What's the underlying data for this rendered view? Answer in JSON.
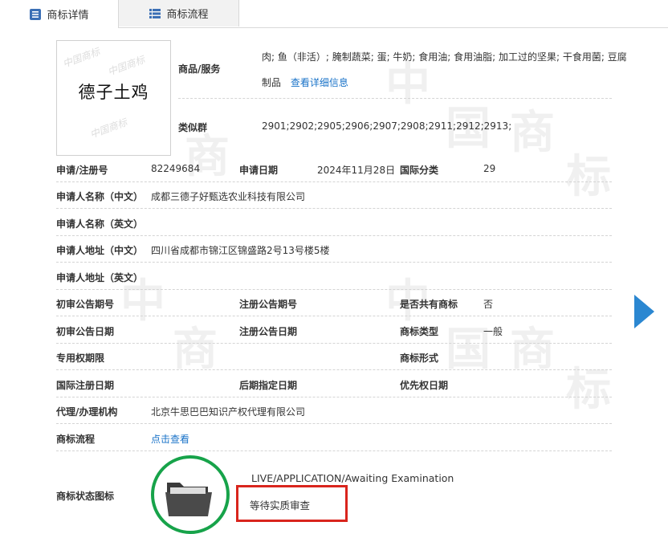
{
  "tabs": [
    {
      "label": "商标详情"
    },
    {
      "label": "商标流程"
    }
  ],
  "trademark": {
    "text": "德子土鸡"
  },
  "goods": {
    "label": "商品/服务",
    "line1": "肉; 鱼（非活）; 腌制蔬菜; 蛋; 牛奶; 食用油; 食用油脂; 加工过的坚果; 干食用菌; 豆腐",
    "line2": "制品",
    "detail_link": "查看详细信息"
  },
  "similar_group": {
    "label": "类似群",
    "value": "2901;2902;2905;2906;2907;2908;2911;2912;2913;"
  },
  "fields": {
    "reg_no_label": "申请/注册号",
    "reg_no": "82249684",
    "apply_date_label": "申请日期",
    "apply_date": "2024年11月28日",
    "intl_class_label": "国际分类",
    "intl_class": "29",
    "applicant_cn_label": "申请人名称（中文）",
    "applicant_cn": "成都三德子好甄选农业科技有限公司",
    "applicant_en_label": "申请人名称（英文）",
    "address_cn_label": "申请人地址（中文）",
    "address_cn": "四川省成都市锦江区锦盛路2号13号楼5楼",
    "address_en_label": "申请人地址（英文）",
    "prelim_no_label": "初审公告期号",
    "reg_pub_no_label": "注册公告期号",
    "shared_label": "是否共有商标",
    "shared": "否",
    "prelim_date_label": "初审公告日期",
    "reg_pub_date_label": "注册公告日期",
    "tm_type_label": "商标类型",
    "tm_type": "一般",
    "exclusive_label": "专用权期限",
    "tm_form_label": "商标形式",
    "intl_reg_date_label": "国际注册日期",
    "later_date_label": "后期指定日期",
    "priority_label": "优先权日期",
    "agent_label": "代理/办理机构",
    "agent": "北京牛思巴巴知识产权代理有限公司",
    "flow_label": "商标流程",
    "flow_link": "点击查看",
    "status_icon_label": "商标状态图标",
    "status_en": "LIVE/APPLICATION/Awaiting Examination",
    "status_cn": "等待实质审查"
  },
  "watermark_chars": [
    "中",
    "国",
    "商",
    "标"
  ],
  "colors": {
    "link": "#1a73c8",
    "arrow": "#2b87d1",
    "status_ring": "#17a34a",
    "highlight_box": "#d9251d"
  }
}
